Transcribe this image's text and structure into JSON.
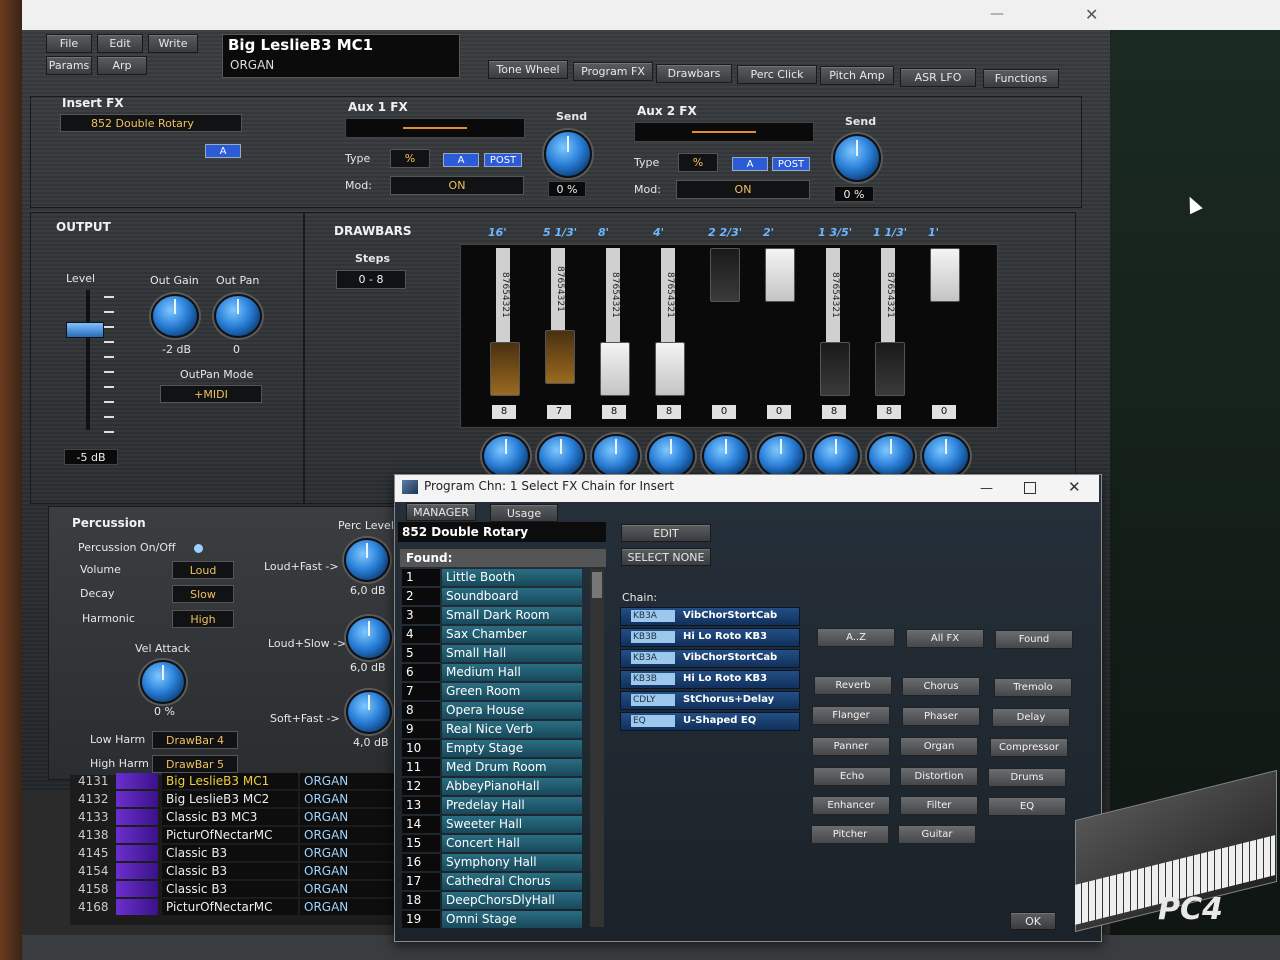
{
  "topbar": {
    "file": "File",
    "edit": "Edit",
    "write": "Write",
    "params": "Params",
    "arp": "Arp"
  },
  "program": {
    "name": "Big LeslieB3 MC1",
    "category": "ORGAN"
  },
  "tabs": [
    "Tone Wheel",
    "Program FX",
    "Drawbars",
    "Perc Click",
    "Pitch Amp",
    "ASR LFO",
    "Functions"
  ],
  "insert_fx": {
    "title": "Insert FX",
    "value": "852  Double Rotary",
    "a": "A"
  },
  "aux1": {
    "title": "Aux 1 FX",
    "type_label": "Type",
    "type_value": "%",
    "a": "A",
    "post": "POST",
    "mod_label": "Mod:",
    "mod_value": "ON",
    "send_label": "Send",
    "send_value": "0 %"
  },
  "aux2": {
    "title": "Aux 2 FX",
    "type_label": "Type",
    "type_value": "%",
    "a": "A",
    "post": "POST",
    "mod_label": "Mod:",
    "mod_value": "ON",
    "send_label": "Send",
    "send_value": "0 %"
  },
  "output": {
    "title": "OUTPUT",
    "level_label": "Level",
    "level_value": "-5 dB",
    "gain_label": "Out Gain",
    "gain_value": "-2 dB",
    "pan_label": "Out Pan",
    "pan_value": "0",
    "panmode_label": "OutPan Mode",
    "panmode_value": "+MIDI"
  },
  "drawbars": {
    "title": "DRAWBARS",
    "steps_label": "Steps",
    "steps_value": "0 - 8",
    "bars": [
      {
        "foot": "16'",
        "value": "8",
        "level": 8,
        "color": "brown"
      },
      {
        "foot": "5 1/3'",
        "value": "7",
        "level": 7,
        "color": "brown"
      },
      {
        "foot": "8'",
        "value": "8",
        "level": 8,
        "color": "white"
      },
      {
        "foot": "4'",
        "value": "8",
        "level": 8,
        "color": "white"
      },
      {
        "foot": "2 2/3'",
        "value": "0",
        "level": 0,
        "color": "black"
      },
      {
        "foot": "2'",
        "value": "0",
        "level": 0,
        "color": "white"
      },
      {
        "foot": "1 3/5'",
        "value": "8",
        "level": 8,
        "color": "black"
      },
      {
        "foot": "1 1/3'",
        "value": "8",
        "level": 8,
        "color": "black"
      },
      {
        "foot": "1'",
        "value": "0",
        "level": 0,
        "color": "white"
      }
    ],
    "scale": "87654321"
  },
  "percussion": {
    "title": "Percussion",
    "onoff_label": "Percussion On/Off",
    "volume_label": "Volume",
    "volume_value": "Loud",
    "decay_label": "Decay",
    "decay_value": "Slow",
    "harmonic_label": "Harmonic",
    "harmonic_value": "High",
    "velattack_label": "Vel Attack",
    "velattack_value": "0 %",
    "lowharm_label": "Low Harm",
    "lowharm_value": "DrawBar  4",
    "highharm_label": "High Harm",
    "highharm_value": "DrawBar  5",
    "perclevel_label": "Perc Level",
    "lf_label": "Loud+Fast ->",
    "lf_value": "6,0 dB",
    "ls_label": "Loud+Slow ->",
    "ls_value": "6,0 dB",
    "sf_label": "Soft+Fast ->",
    "sf_value": "4,0 dB"
  },
  "program_list": [
    {
      "num": "4131",
      "name": "Big LeslieB3 MC1",
      "cat": "ORGAN"
    },
    {
      "num": "4132",
      "name": "Big LeslieB3 MC2",
      "cat": "ORGAN"
    },
    {
      "num": "4133",
      "name": "Classic B3 MC3",
      "cat": "ORGAN"
    },
    {
      "num": "4138",
      "name": "PicturOfNectarMC",
      "cat": "ORGAN"
    },
    {
      "num": "4145",
      "name": "Classic B3",
      "cat": "ORGAN"
    },
    {
      "num": "4154",
      "name": "Classic B3",
      "cat": "ORGAN"
    },
    {
      "num": "4158",
      "name": "Classic B3",
      "cat": "ORGAN"
    },
    {
      "num": "4168",
      "name": "PicturOfNectarMC",
      "cat": "ORGAN"
    }
  ],
  "dialog": {
    "title": "Program Chn: 1  Select FX Chain for Insert",
    "manager": "MANAGER",
    "usage": "Usage",
    "current": "852  Double Rotary",
    "edit": "EDIT",
    "select_none": "SELECT NONE",
    "found_label": "Found:",
    "chain_label": "Chain:",
    "found": [
      "Little Booth",
      "Soundboard",
      "Small Dark Room",
      "Sax Chamber",
      "Small Hall",
      "Medium Hall",
      "Green Room",
      "Opera House",
      "Real Nice Verb",
      "Empty Stage",
      "Med Drum Room",
      "AbbeyPianoHall",
      "Predelay Hall",
      "Sweeter Hall",
      "Concert Hall",
      "Symphony Hall",
      "Cathedral Chorus",
      "DeepChorsDlyHall",
      "Omni Stage"
    ],
    "chain": [
      {
        "tag": "KB3A",
        "name": "VibChorStortCab"
      },
      {
        "tag": "KB3B",
        "name": "Hi Lo Roto KB3"
      },
      {
        "tag": "KB3A",
        "name": "VibChorStortCab"
      },
      {
        "tag": "KB3B",
        "name": "Hi Lo Roto KB3"
      },
      {
        "tag": "CDLY",
        "name": "StChorus+Delay"
      },
      {
        "tag": "EQ",
        "name": "U-Shaped EQ"
      }
    ],
    "sort": [
      "A..Z",
      "All FX",
      "Found"
    ],
    "categories": [
      "Reverb",
      "Chorus",
      "Tremolo",
      "Flanger",
      "Phaser",
      "Delay",
      "Panner",
      "Organ",
      "Compressor",
      "Echo",
      "Distortion",
      "Drums",
      "Enhancer",
      "Filter",
      "EQ",
      "Pitcher",
      "Guitar"
    ],
    "ok": "OK"
  },
  "brand": "PC4"
}
